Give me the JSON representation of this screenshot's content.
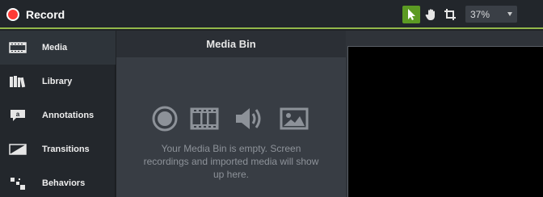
{
  "toolbar": {
    "record_label": "Record",
    "zoom_value": "37%",
    "accent_color": "#93b84a",
    "active_tool_color": "#5c9a23",
    "record_color": "#ff3a35"
  },
  "sidebar": {
    "items": [
      {
        "label": "Media",
        "icon": "film-strip-icon",
        "active": true
      },
      {
        "label": "Library",
        "icon": "books-icon",
        "active": false
      },
      {
        "label": "Annotations",
        "icon": "callout-icon",
        "active": false
      },
      {
        "label": "Transitions",
        "icon": "transition-icon",
        "active": false
      },
      {
        "label": "Behaviors",
        "icon": "behaviors-icon",
        "active": false
      }
    ]
  },
  "media_bin": {
    "title": "Media Bin",
    "empty_message": "Your Media Bin is empty. Screen recordings and imported media will show up here.",
    "icons": [
      "record-circle-icon",
      "video-icon",
      "audio-icon",
      "image-icon"
    ]
  }
}
